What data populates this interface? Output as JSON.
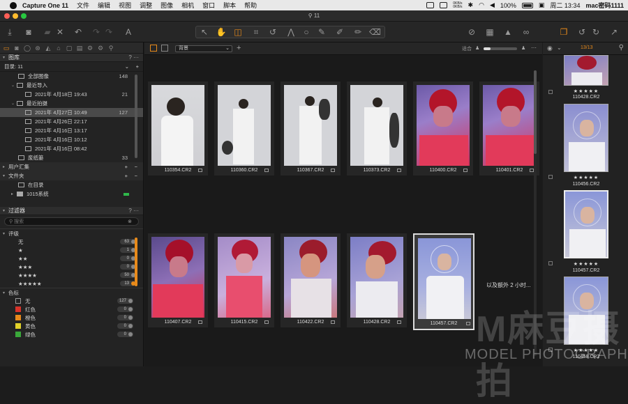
{
  "menubar": {
    "app": "Capture One 11",
    "items": [
      "文件",
      "编辑",
      "视图",
      "调整",
      "图像",
      "相机",
      "窗口",
      "脚本",
      "帮助"
    ],
    "battery": "100%",
    "clock": "周二 13:34",
    "user": "mac密码1111",
    "net_up": "0KB/s",
    "net_down": "0KB/s"
  },
  "window": {
    "title": "11"
  },
  "library": {
    "header": "图库",
    "catalog_label": "目录: 11",
    "items": [
      {
        "label": "全部图像",
        "count": "148"
      },
      {
        "label": "最近导入",
        "count": ""
      },
      {
        "label": "2021年 4月18日 19:43",
        "count": "21"
      },
      {
        "label": "最近拍摄",
        "count": ""
      },
      {
        "label": "2021年 4月27日 10:49",
        "count": "127"
      },
      {
        "label": "2021年 4月26日 22:17",
        "count": ""
      },
      {
        "label": "2021年 4月16日 13:17",
        "count": ""
      },
      {
        "label": "2021年 4月16日 10:12",
        "count": ""
      },
      {
        "label": "2021年 4月16日 08:42",
        "count": ""
      },
      {
        "label": "废纸篓",
        "count": "33"
      }
    ],
    "user_collections": "用户汇集",
    "folders": "文件夹",
    "in_catalog": "在目录",
    "volume": "1015系统"
  },
  "filters": {
    "header": "过滤器",
    "search_placeholder": "搜索",
    "rating_header": "评级",
    "ratings": [
      {
        "label": "无",
        "count": "63"
      },
      {
        "label": "★",
        "count": "1"
      },
      {
        "label": "★★",
        "count": "0"
      },
      {
        "label": "★★★",
        "count": "0"
      },
      {
        "label": "★★★★",
        "count": "50"
      },
      {
        "label": "★★★★★",
        "count": "13"
      }
    ],
    "color_header": "色标",
    "colors": [
      {
        "label": "无",
        "count": "127",
        "color": "#222222"
      },
      {
        "label": "红色",
        "count": "0",
        "color": "#d8332a"
      },
      {
        "label": "橙色",
        "count": "0",
        "color": "#e88a1a"
      },
      {
        "label": "黄色",
        "count": "0",
        "color": "#e2d22a"
      },
      {
        "label": "绿色",
        "count": "0",
        "color": "#3aa83a"
      }
    ]
  },
  "browser": {
    "sort_value": "背景",
    "sort_label": "适合",
    "more_text": "以及额外 2 小时...",
    "thumbnails": [
      "110354.CR2",
      "110360.CR2",
      "110367.CR2",
      "110373.CR2",
      "110400.CR2",
      "110401.CR2",
      "110407.CR2",
      "110415.CR2",
      "110422.CR2",
      "110428.CR2",
      "110457.CR2"
    ]
  },
  "filmstrip": {
    "counter": "13/13",
    "items": [
      {
        "name": "110428.CR2",
        "stars": "★★★★★"
      },
      {
        "name": "110456.CR2",
        "stars": "★★★★★"
      },
      {
        "name": "110457.CR2",
        "stars": "★★★★★"
      },
      {
        "name": "110458.CR2",
        "stars": "★★★★★"
      }
    ]
  },
  "watermark": {
    "big": "M麻豆摄拍",
    "small": "MODEL PHOTOGRAPH"
  },
  "colors": {
    "accent": "#e88a1a",
    "selection": "#4a4a4a"
  }
}
